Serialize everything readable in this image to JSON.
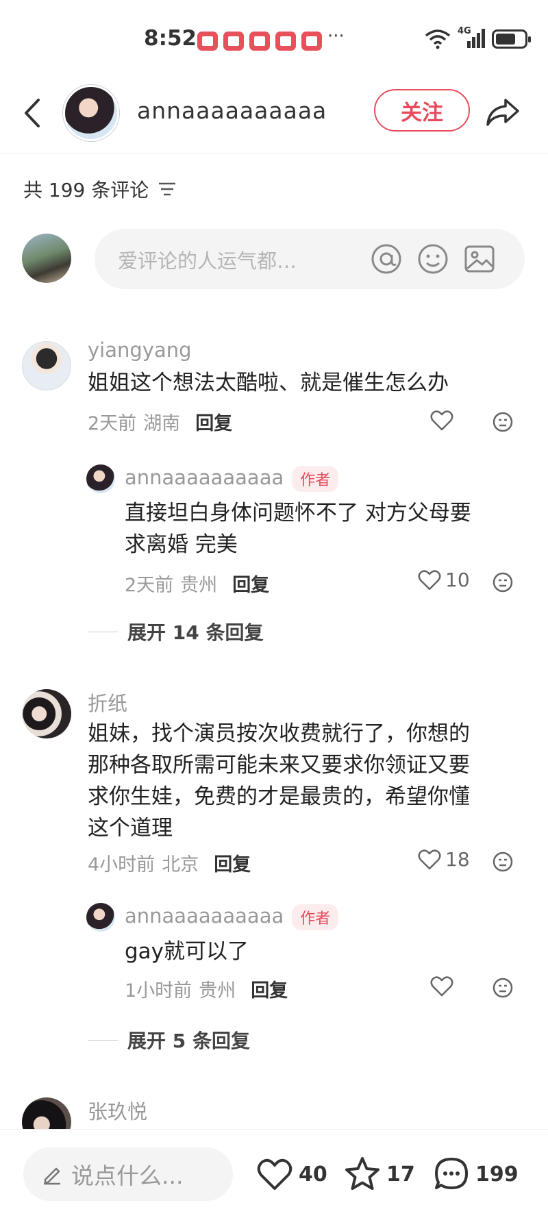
{
  "status_bar": {
    "time": "8:52",
    "more": "···",
    "network": "4G"
  },
  "header": {
    "author_name": "annaaaaaaaaaa",
    "follow_label": "关注"
  },
  "comments_header": {
    "count_label": "共 199 条评论"
  },
  "input": {
    "placeholder": "爱评论的人运气都…"
  },
  "comments": [
    {
      "name": "yiangyang",
      "text": "姐姐这个想法太酷啦、就是催生怎么办",
      "time": "2天前",
      "location": "湖南",
      "reply_label": "回复",
      "likes": "",
      "reply": {
        "name": "annaaaaaaaaaa",
        "badge": "作者",
        "text_line1": "直接坦白身体问题怀不了 对方父母要",
        "text_line2": "求离婚 完美",
        "time": "2天前",
        "location": "贵州",
        "reply_label": "回复",
        "likes": "10"
      },
      "expand_label": "展开 14 条回复"
    },
    {
      "name": "折纸",
      "text_line1": "姐妹，找个演员按次收费就行了，你想的",
      "text_line2": "那种各取所需可能未来又要求你领证又要",
      "text_line3": "求你生娃，免费的才是最贵的，希望你懂",
      "text_line4": "这个道理",
      "time": "4小时前",
      "location": "北京",
      "reply_label": "回复",
      "likes": "18",
      "reply": {
        "name": "annaaaaaaaaaa",
        "badge": "作者",
        "text": "gay就可以了",
        "time": "1小时前",
        "location": "贵州",
        "reply_label": "回复",
        "likes": ""
      },
      "expand_label": "展开 5 条回复"
    },
    {
      "name": "张玖悦"
    }
  ],
  "bottom_bar": {
    "input_placeholder": "说点什么...",
    "likes": "40",
    "favorites": "17",
    "comments": "199"
  },
  "colors": {
    "accent": "#e84b5c",
    "badge_bg": "#fdecee",
    "muted": "#999999"
  }
}
